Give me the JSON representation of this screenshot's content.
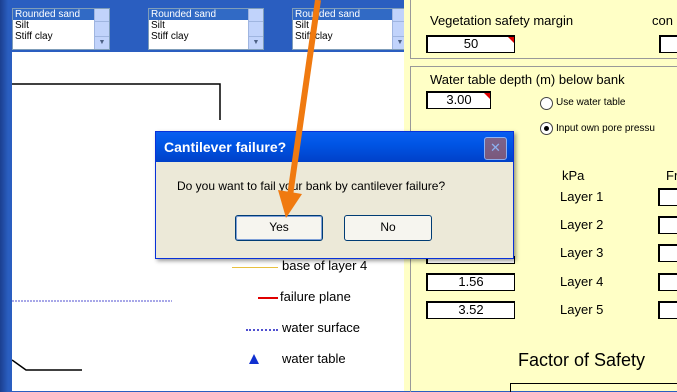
{
  "soil_lists": [
    {
      "options": [
        "Rounded sand",
        "Silt",
        "Stiff clay"
      ],
      "selected": "Rounded sand"
    },
    {
      "options": [
        "Rounded sand",
        "Silt",
        "Stiff clay"
      ],
      "selected": "Rounded sand"
    },
    {
      "options": [
        "Rounded sand",
        "Silt",
        "Stiff clay"
      ],
      "selected": "Rounded sand"
    }
  ],
  "right_panel": {
    "vegetation_label": "Vegetation safety margin",
    "vegetation_value": "50",
    "cut_label": "con",
    "water_table_label": "Water table depth (m) below bank",
    "water_table_value": "3.00",
    "radio_use_water_table": "Use water table",
    "radio_own_pore": "Input own pore pressu",
    "kpa_header": "kPa",
    "fr_header": "Fr",
    "layers": [
      "Layer 1",
      "Layer 2",
      "Layer 3",
      "Layer 4",
      "Layer 5"
    ],
    "pressures": [
      "1.56",
      "3.52"
    ],
    "factor_of_safety_label": "Factor of Safety"
  },
  "legend": [
    {
      "label": "base of layer 4",
      "color": "#e8c040"
    },
    {
      "label": "failure plane",
      "color": "#e00000"
    },
    {
      "label": "water surface",
      "color": "#5050d0"
    },
    {
      "label": "water table",
      "color": "#1030d0"
    }
  ],
  "dialog": {
    "title": "Cantilever failure?",
    "message": "Do you want to fail your bank by cantilever failure?",
    "yes_label": "Yes",
    "no_label": "No"
  },
  "annotation_arrow_color": "#f07a10"
}
